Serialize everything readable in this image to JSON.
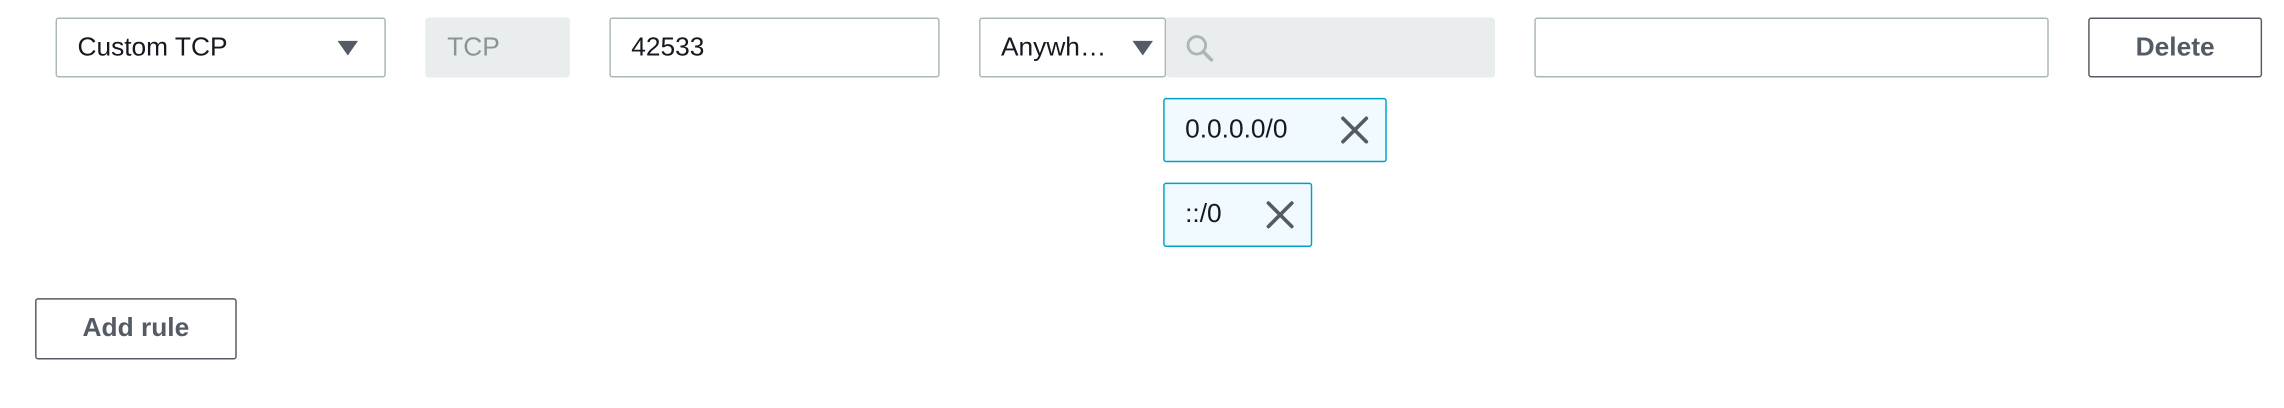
{
  "rule": {
    "type_select": {
      "value": "Custom TCP",
      "icon": "caret-down-icon"
    },
    "protocol": {
      "value": "TCP"
    },
    "port_range": {
      "value": "42533"
    },
    "source_select": {
      "value": "Anywh…",
      "icon": "caret-down-icon"
    },
    "cidr_search": {
      "value": "",
      "placeholder": "",
      "icon": "search-icon"
    },
    "tokens": [
      {
        "label": "0.0.0.0/0",
        "icon": "close-icon"
      },
      {
        "label": "::/0",
        "icon": "close-icon"
      }
    ],
    "description": {
      "value": "",
      "placeholder": ""
    },
    "delete_label": "Delete"
  },
  "add_rule_label": "Add rule",
  "colors": {
    "border": "#aab7b8",
    "disabled_bg": "#eaeded",
    "token_border": "#00a1c9",
    "token_bg": "#f1faff",
    "button_text": "#545b64"
  }
}
